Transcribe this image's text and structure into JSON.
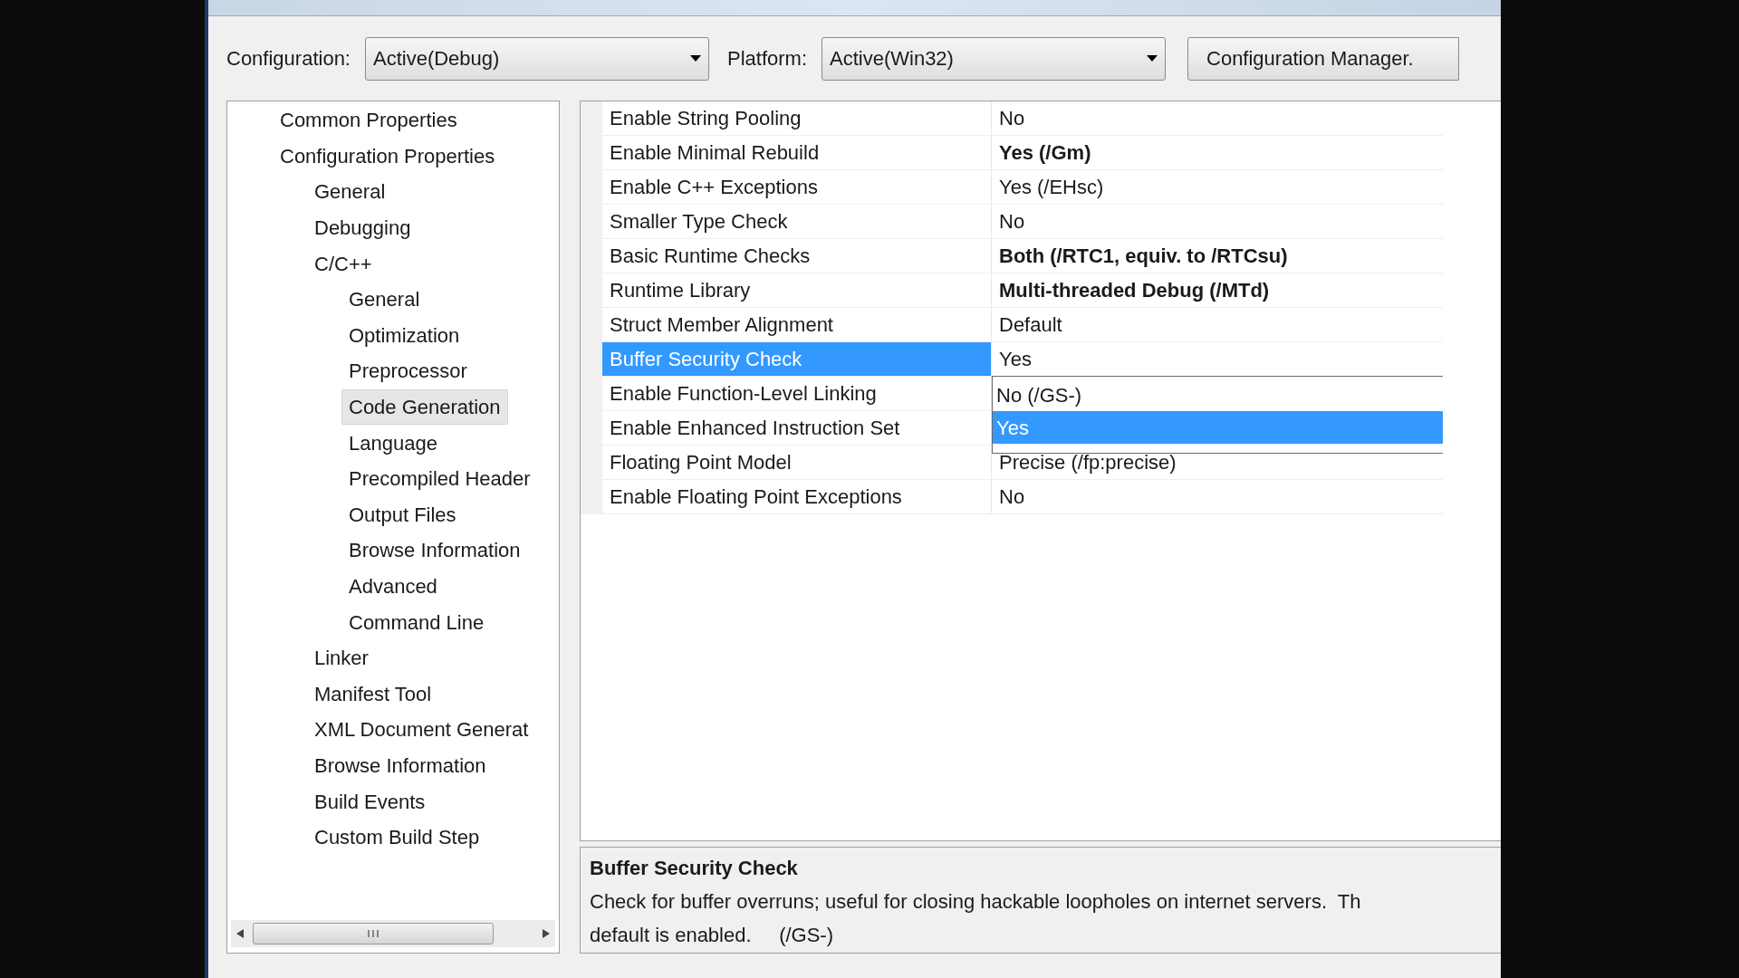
{
  "toolbar": {
    "configuration_label": "Configuration:",
    "configuration_value": "Active(Debug)",
    "platform_label": "Platform:",
    "platform_value": "Active(Win32)",
    "manager_button": "Configuration Manager."
  },
  "tree": [
    {
      "label": "Common Properties",
      "selected": false
    },
    {
      "label": "Configuration Properties",
      "selected": false,
      "children": [
        {
          "label": "General",
          "selected": false
        },
        {
          "label": "Debugging",
          "selected": false
        },
        {
          "label": "C/C++",
          "selected": false,
          "children": [
            {
              "label": "General",
              "selected": false
            },
            {
              "label": "Optimization",
              "selected": false
            },
            {
              "label": "Preprocessor",
              "selected": false
            },
            {
              "label": "Code Generation",
              "selected": true
            },
            {
              "label": "Language",
              "selected": false
            },
            {
              "label": "Precompiled Header",
              "selected": false
            },
            {
              "label": "Output Files",
              "selected": false
            },
            {
              "label": "Browse Information",
              "selected": false
            },
            {
              "label": "Advanced",
              "selected": false
            },
            {
              "label": "Command Line",
              "selected": false
            }
          ]
        },
        {
          "label": "Linker",
          "selected": false
        },
        {
          "label": "Manifest Tool",
          "selected": false
        },
        {
          "label": "XML Document Generat",
          "selected": false
        },
        {
          "label": "Browse Information",
          "selected": false
        },
        {
          "label": "Build Events",
          "selected": false
        },
        {
          "label": "Custom Build Step",
          "selected": false
        }
      ]
    }
  ],
  "properties": [
    {
      "name": "Enable String Pooling",
      "value": "No",
      "bold": false,
      "selected": false
    },
    {
      "name": "Enable Minimal Rebuild",
      "value": "Yes (/Gm)",
      "bold": true,
      "selected": false
    },
    {
      "name": "Enable C++ Exceptions",
      "value": "Yes (/EHsc)",
      "bold": false,
      "selected": false
    },
    {
      "name": "Smaller Type Check",
      "value": "No",
      "bold": false,
      "selected": false
    },
    {
      "name": "Basic Runtime Checks",
      "value": "Both (/RTC1, equiv. to /RTCsu)",
      "bold": true,
      "selected": false
    },
    {
      "name": "Runtime Library",
      "value": "Multi-threaded Debug (/MTd)",
      "bold": true,
      "selected": false
    },
    {
      "name": "Struct Member Alignment",
      "value": "Default",
      "bold": false,
      "selected": false
    },
    {
      "name": "Buffer Security Check",
      "value": "Yes",
      "bold": false,
      "selected": true
    },
    {
      "name": "Enable Function-Level Linking",
      "selected": false
    },
    {
      "name": "Enable Enhanced Instruction Set",
      "selected": false
    },
    {
      "name": "Floating Point Model",
      "value": "Precise (/fp:precise)",
      "bold": false,
      "selected": false
    },
    {
      "name": "Enable Floating Point Exceptions",
      "value": "No",
      "bold": false,
      "selected": false
    }
  ],
  "dropdown": {
    "options": [
      {
        "label": "No (/GS-)",
        "selected": false
      },
      {
        "label": "Yes",
        "selected": true
      }
    ]
  },
  "description": {
    "title": "Buffer Security Check",
    "lines": [
      "Check for buffer overruns; useful for closing hackable loopholes on internet servers.  Th",
      "default is enabled.     (/GS-)"
    ]
  }
}
